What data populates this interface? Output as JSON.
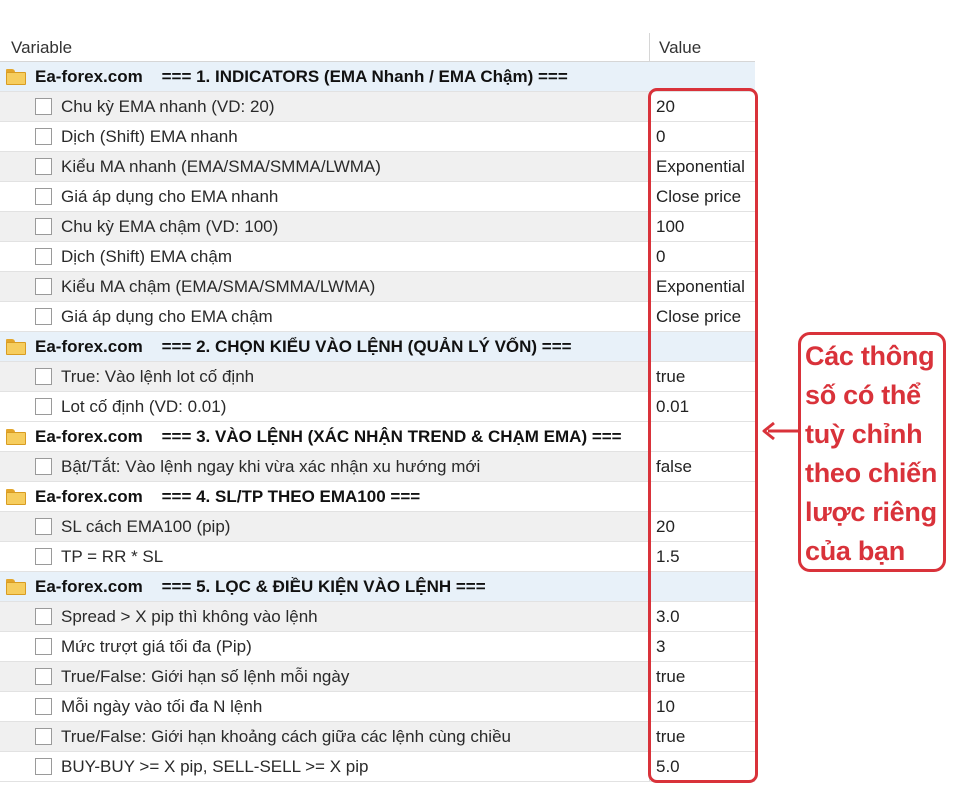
{
  "columns": {
    "variable": "Variable",
    "value": "Value"
  },
  "groups": [
    {
      "title": "Ea-forex.com    === 1. INDICATORS (EMA Nhanh / EMA Chậm) ===",
      "rows": [
        {
          "label": "Chu kỳ EMA nhanh (VD: 20)",
          "value": "20",
          "checked": false
        },
        {
          "label": "Dịch (Shift) EMA nhanh",
          "value": "0",
          "checked": false
        },
        {
          "label": "Kiểu MA nhanh (EMA/SMA/SMMA/LWMA)",
          "value": "Exponential",
          "checked": false
        },
        {
          "label": "Giá áp dụng cho EMA nhanh",
          "value": "Close price",
          "checked": false
        },
        {
          "label": "Chu kỳ EMA chậm (VD: 100)",
          "value": "100",
          "checked": false
        },
        {
          "label": "Dịch (Shift) EMA chậm",
          "value": "0",
          "checked": false
        },
        {
          "label": "Kiểu MA chậm (EMA/SMA/SMMA/LWMA)",
          "value": "Exponential",
          "checked": false
        },
        {
          "label": "Giá áp dụng cho EMA chậm",
          "value": "Close price",
          "checked": false
        }
      ]
    },
    {
      "title": "Ea-forex.com    === 2. CHỌN KIỂU VÀO LỆNH (QUẢN LÝ VỐN) ===",
      "rows": [
        {
          "label": "True: Vào lệnh lot cố định",
          "value": "true",
          "checked": false
        },
        {
          "label": "Lot cố định (VD: 0.01)",
          "value": "0.01",
          "checked": false
        }
      ]
    },
    {
      "title": "Ea-forex.com    === 3. VÀO LỆNH (XÁC NHẬN TREND & CHẠM EMA) ===",
      "rows": [
        {
          "label": "Bật/Tắt: Vào lệnh ngay khi vừa xác nhận xu hướng mới",
          "value": "false",
          "checked": false
        }
      ]
    },
    {
      "title": "Ea-forex.com    === 4. SL/TP THEO EMA100 ===",
      "rows": [
        {
          "label": "SL cách EMA100 (pip)",
          "value": "20",
          "checked": false
        },
        {
          "label": "TP = RR * SL",
          "value": "1.5",
          "checked": false
        }
      ]
    },
    {
      "title": "Ea-forex.com    === 5. LỌC & ĐIỀU KIỆN VÀO LỆNH ===",
      "rows": [
        {
          "label": "Spread > X pip thì không vào lệnh",
          "value": "3.0",
          "checked": false
        },
        {
          "label": "Mức trượt giá tối đa (Pip)",
          "value": "3",
          "checked": false
        },
        {
          "label": "True/False: Giới hạn số lệnh mỗi ngày",
          "value": "true",
          "checked": false
        },
        {
          "label": "Mỗi ngày vào tối đa N lệnh",
          "value": "10",
          "checked": false
        },
        {
          "label": "True/False: Giới hạn khoảng cách giữa các lệnh cùng chiều",
          "value": "true",
          "checked": false
        },
        {
          "label": "BUY-BUY >= X pip, SELL-SELL >= X pip",
          "value": "5.0",
          "checked": false
        }
      ]
    }
  ],
  "callout": {
    "lines": [
      "Các thông",
      "số có thể",
      "tuỳ chỉnh",
      "theo chiến",
      "lược riêng",
      "của bạn"
    ],
    "color": "#d9323a"
  },
  "icons": {
    "group": "folder-icon",
    "row": "checkbox",
    "arrow": "arrow-left-icon"
  }
}
